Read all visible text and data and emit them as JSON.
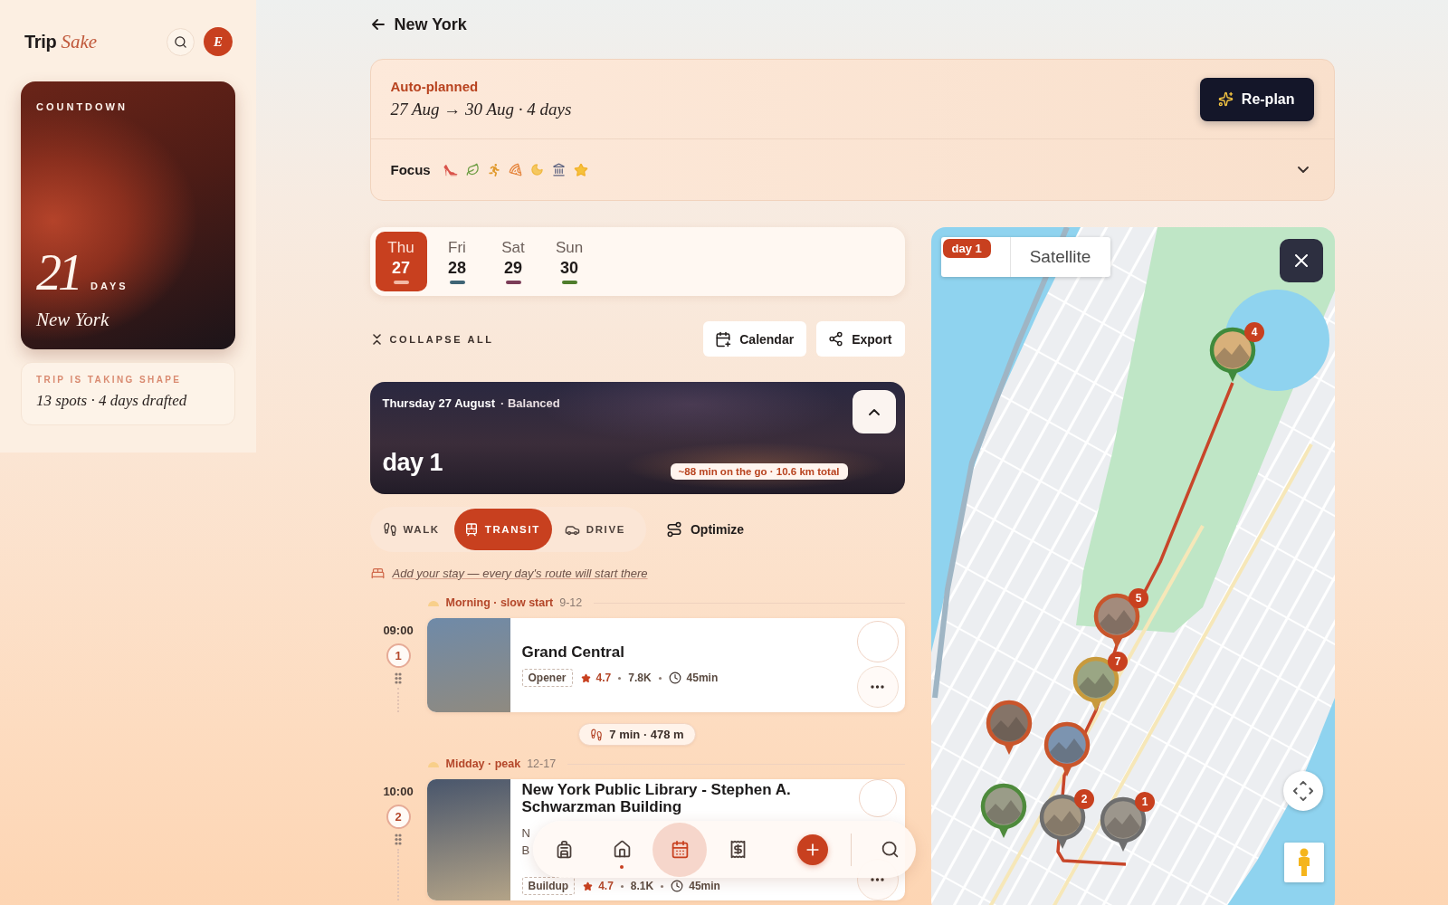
{
  "sidebar": {
    "logo": {
      "word": "Trip",
      "accent": "Sake"
    },
    "avatar": "E",
    "countdown": {
      "label": "COUNTDOWN",
      "number": "21",
      "unit": "DAYS",
      "city": "New York"
    },
    "status": {
      "label": "TRIP IS TAKING SHAPE",
      "text": "13 spots · 4 days drafted"
    }
  },
  "header": {
    "title": "New York"
  },
  "plan": {
    "label": "Auto-planned",
    "dates": "27 Aug → 30 Aug · 4 days",
    "button": "Re-plan",
    "focus": {
      "label": "Focus",
      "expanded": false,
      "icons": [
        {
          "kind": "heel"
        },
        {
          "kind": "herb"
        },
        {
          "kind": "runner"
        },
        {
          "kind": "pizza"
        },
        {
          "kind": "moon"
        },
        {
          "kind": "museum"
        },
        {
          "kind": "star"
        }
      ]
    }
  },
  "day_tabs": [
    {
      "weekday": "Thu",
      "date": "27",
      "selected": true,
      "color": "#f3b9a6"
    },
    {
      "weekday": "Fri",
      "date": "28",
      "selected": false,
      "color": "#3f6475"
    },
    {
      "weekday": "Sat",
      "date": "29",
      "selected": false,
      "color": "#7b3c57"
    },
    {
      "weekday": "Sun",
      "date": "30",
      "selected": false,
      "color": "#4f7d2c"
    }
  ],
  "toolbar": {
    "collapse": "COLLAPSE ALL",
    "buttons": [
      {
        "kind": "calendar",
        "label": "Calendar"
      },
      {
        "kind": "share",
        "label": "Export"
      }
    ]
  },
  "day": {
    "date": "Thursday 27 August",
    "pace": "· Balanced",
    "title": "day 1",
    "summary": "~88 min on the go · 10.6 km total",
    "expanded": true
  },
  "modes": [
    {
      "kind": "walk",
      "label": "WALK",
      "selected": false
    },
    {
      "kind": "transit",
      "label": "TRANSIT",
      "selected": true
    },
    {
      "kind": "drive",
      "label": "DRIVE",
      "selected": false
    }
  ],
  "optimize": "Optimize",
  "stay_link": "Add your stay — every day's route will start there",
  "timeline": [
    {
      "kind": "section",
      "title": "Morning · slow start",
      "hours": "9-12"
    },
    {
      "kind": "stop",
      "time": "09:00",
      "number": "1",
      "title": "Grand Central",
      "tag": "Opener",
      "rating": "4.7",
      "reviews": "7.8K",
      "duration": "45min",
      "checked": false
    },
    {
      "kind": "leg",
      "text": "7 min · 478 m"
    },
    {
      "kind": "section",
      "title": "Midday · peak",
      "hours": "12-17"
    },
    {
      "kind": "stop",
      "time": "10:00",
      "number": "2",
      "title": "New York Public Library - Stephen A. Schwarzman Building",
      "description": [
        "N",
        "B"
      ],
      "tag": "Buildup",
      "rating": "4.7",
      "reviews": "8.1K",
      "duration": "45min",
      "checked": false
    }
  ],
  "bottom_nav": [
    {
      "kind": "backpack",
      "selected": false,
      "pressed": false
    },
    {
      "kind": "home",
      "selected": true,
      "pressed": false
    },
    {
      "kind": "calendar",
      "selected": false,
      "pressed": true
    },
    {
      "kind": "receipt",
      "selected": false,
      "pressed": false
    },
    {
      "kind": "add",
      "selected": false,
      "pressed": false
    },
    {
      "kind": "search",
      "selected": false,
      "pressed": false
    }
  ],
  "map": {
    "day_badge": "day 1",
    "view_tabs": [
      {
        "label": "Satellite",
        "selected": false
      }
    ],
    "pins": [
      {
        "number": "4",
        "color": "#3f8a3c"
      },
      {
        "number": "5",
        "color": "#c9552b"
      },
      {
        "number": "7",
        "color": "#c89a3c"
      },
      {
        "color": "#c9552b"
      },
      {
        "color": "#c9552b"
      },
      {
        "color": "#4e8a3c"
      },
      {
        "number": "2",
        "color": "#6e6e6e"
      },
      {
        "number": "1",
        "color": "#6e6e6e"
      }
    ]
  }
}
